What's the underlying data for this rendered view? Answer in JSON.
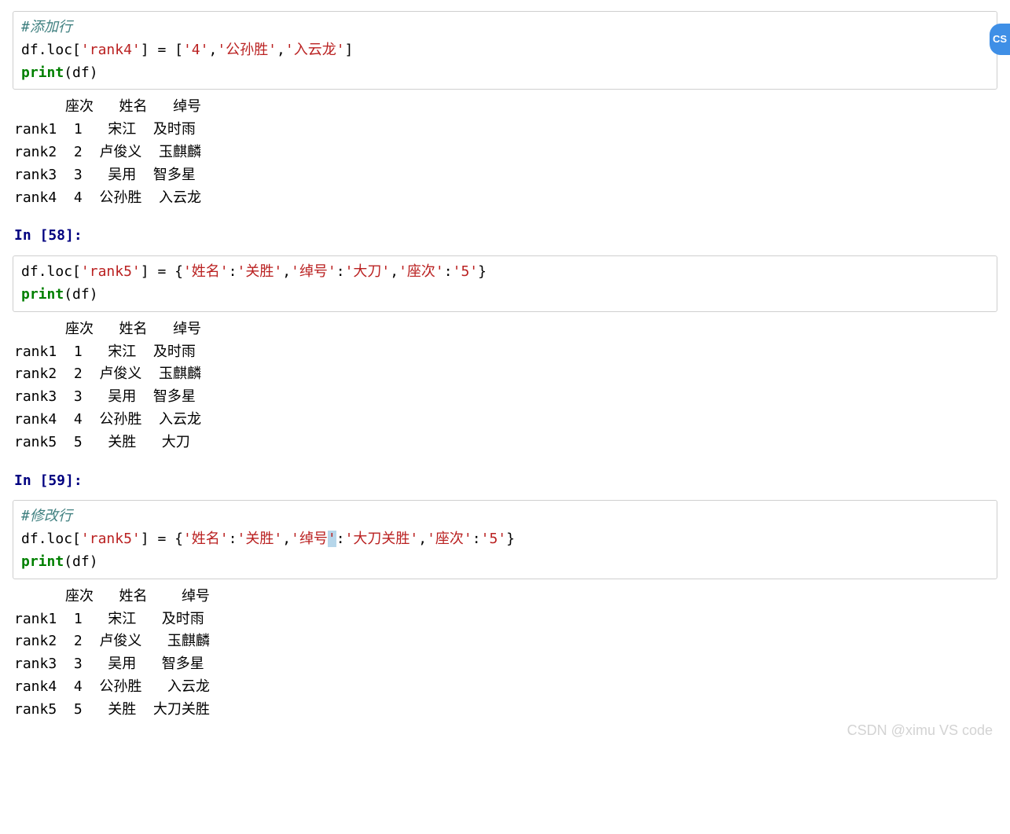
{
  "cells": [
    {
      "code_html": "<span class='c' data-name='code-comment' data-interactable='false'>#添加行</span>\n<span class='nv'>df</span><span class='p'>.</span><span class='nv'>loc</span><span class='p'>[</span><span class='s'>'rank4'</span><span class='p'>]</span> <span class='p'>=</span> <span class='p'>[</span><span class='s'>'4'</span><span class='p'>,</span><span class='s'>'公孙胜'</span><span class='p'>,</span><span class='s'>'入云龙'</span><span class='p'>]</span>\n<span class='kw'>print</span><span class='p'>(</span><span class='nv'>df</span><span class='p'>)</span>",
      "output": "      座次   姓名   绰号\nrank1  1   宋江  及时雨\nrank2  2  卢俊义  玉麒麟\nrank3  3   吴用  智多星\nrank4  4  公孙胜  入云龙",
      "prompt_after": "In [58]:"
    },
    {
      "code_html": "<span class='nv'>df</span><span class='p'>.</span><span class='nv'>loc</span><span class='p'>[</span><span class='s'>'rank5'</span><span class='p'>]</span> <span class='p'>=</span> <span class='p'>{</span><span class='s'>'姓名'</span><span class='p'>:</span><span class='s'>'关胜'</span><span class='p'>,</span><span class='s'>'绰号'</span><span class='p'>:</span><span class='s'>'大刀'</span><span class='p'>,</span><span class='s'>'座次'</span><span class='p'>:</span><span class='s'>'5'</span><span class='p'>}</span>\n<span class='kw'>print</span><span class='p'>(</span><span class='nv'>df</span><span class='p'>)</span>",
      "output": "      座次   姓名   绰号\nrank1  1   宋江  及时雨\nrank2  2  卢俊义  玉麒麟\nrank3  3   吴用  智多星\nrank4  4  公孙胜  入云龙\nrank5  5   关胜   大刀",
      "prompt_after": "In [59]:"
    },
    {
      "code_html": "<span class='c' data-name='code-comment' data-interactable='false'>#修改行</span>\n<span class='nv'>df</span><span class='p'>.</span><span class='nv'>loc</span><span class='p'>[</span><span class='s'>'rank5'</span><span class='p'>]</span> <span class='p'>=</span> <span class='p'>{</span><span class='s'>'姓名'</span><span class='p'>:</span><span class='s'>'关胜'</span><span class='p'>,</span><span class='s'>'绰号<span class='hl-sel' data-name='text-selection' data-interactable='false'>'</span></span><span class='p'>:</span><span class='s'>'大刀关胜'</span><span class='p'>,</span><span class='s'>'座次'</span><span class='p'>:</span><span class='s'>'5'</span><span class='p'>}</span>\n<span class='kw'>print</span><span class='p'>(</span><span class='nv'>df</span><span class='p'>)</span>",
      "output": "      座次   姓名    绰号\nrank1  1   宋江   及时雨\nrank2  2  卢俊义   玉麒麟\nrank3  3   吴用   智多星\nrank4  4  公孙胜   入云龙\nrank5  5   关胜  大刀关胜",
      "prompt_after": ""
    }
  ],
  "watermark": "CSDN @ximu VS code",
  "badge_text": "CS"
}
